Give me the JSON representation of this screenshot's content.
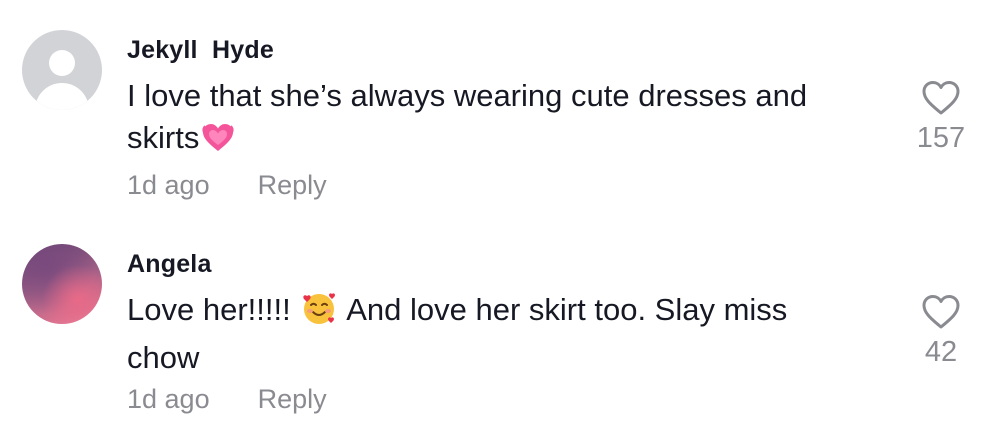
{
  "comments": [
    {
      "avatar": "default-avatar",
      "username": "Jekyll  Hyde",
      "text_before": "I love that she’s always wearing cute dresses and skirts",
      "emoji": "pink-heart-emoji",
      "text_after": "",
      "time": "1d ago",
      "reply_label": "Reply",
      "like_icon": "heart-outline-icon",
      "likes": "157"
    },
    {
      "avatar": "photo-avatar",
      "username": "Angela",
      "text_before": "Love her!!!!!",
      "emoji": "smiling-face-with-hearts-emoji",
      "text_after": "And love her skirt too. Slay miss chow",
      "time": "1d ago",
      "reply_label": "Reply",
      "like_icon": "heart-outline-icon",
      "likes": "42"
    }
  ],
  "colors": {
    "text": "#161823",
    "secondary": "#8a8b91",
    "avatar_default_bg": "#d2d3d6"
  }
}
